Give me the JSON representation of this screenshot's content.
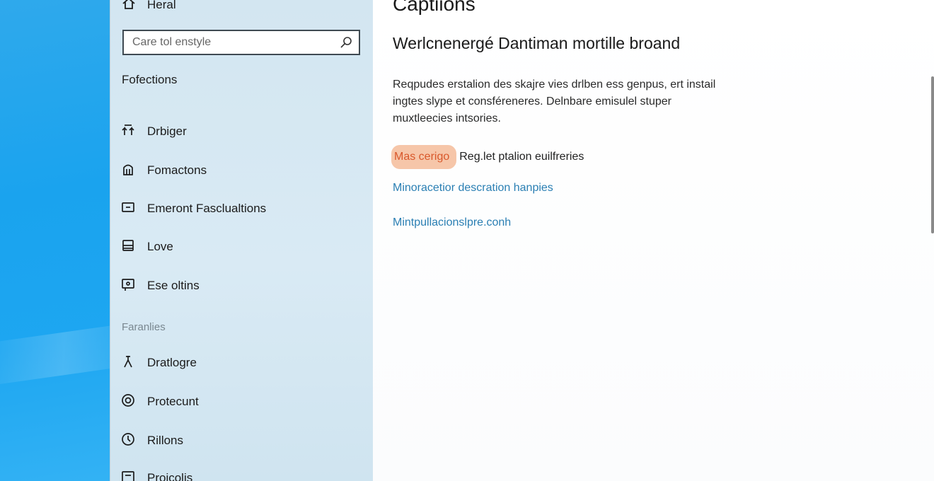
{
  "nav": {
    "home_label": "Heral",
    "search_placeholder": "Care tol enstyle",
    "section_label": "Fofections",
    "items": [
      {
        "label": "Drbiger",
        "icon": "network-icon"
      },
      {
        "label": "Fomactons",
        "icon": "shield-icon"
      },
      {
        "label": "Emeront Fasclualtions",
        "icon": "monitor-icon"
      },
      {
        "label": "Love",
        "icon": "drive-icon"
      },
      {
        "label": "Ese oltins",
        "icon": "display-icon"
      }
    ],
    "group_label": "Faranlies",
    "items2": [
      {
        "label": "Dratlogre",
        "icon": "person-icon"
      },
      {
        "label": "Protecunt",
        "icon": "target-icon"
      },
      {
        "label": "Rillons",
        "icon": "clock-icon"
      },
      {
        "label": "Proicolis",
        "icon": "tablet-icon"
      }
    ]
  },
  "content": {
    "page_title": "Captiions",
    "subtitle": "Werlcnenergé Dantiman mortille broand",
    "description": "Reqpudes erstalion des skajre vies drlben ess genpus, ert instail ingtes slype et consféreneres. Delnbare emisulel stuper muxtleecies intsories.",
    "highlight_text": "Mas cerigo",
    "inline_text": "Reg.let ptalion euilfreries",
    "link1": "Minoracetior descration hanpies",
    "link2": "Mintpullacionslpre.conh"
  }
}
